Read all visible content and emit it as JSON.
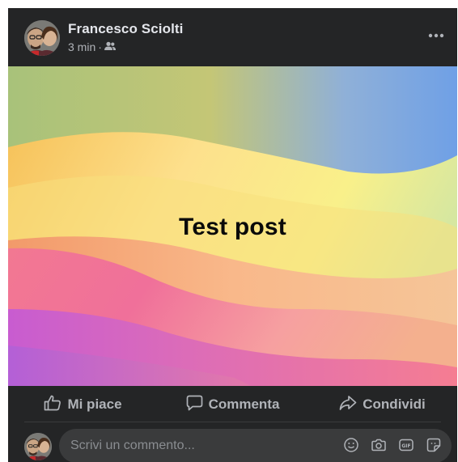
{
  "post": {
    "author": "Francesco Sciolti",
    "time": "3 min",
    "separator": "·",
    "audience_icon": "friends-icon",
    "more_icon": "more-options-icon",
    "image_text": "Test post"
  },
  "actions": {
    "like": "Mi piace",
    "comment": "Commenta",
    "share": "Condividi"
  },
  "comment_input": {
    "placeholder": "Scrivi un commento...",
    "icons": [
      "emoji-icon",
      "camera-icon",
      "gif-icon",
      "sticker-icon"
    ]
  },
  "colors": {
    "card_background": "#242526",
    "primary_text": "#e4e6eb",
    "secondary_text": "#b0b3b8",
    "input_background": "#3a3b3c"
  }
}
